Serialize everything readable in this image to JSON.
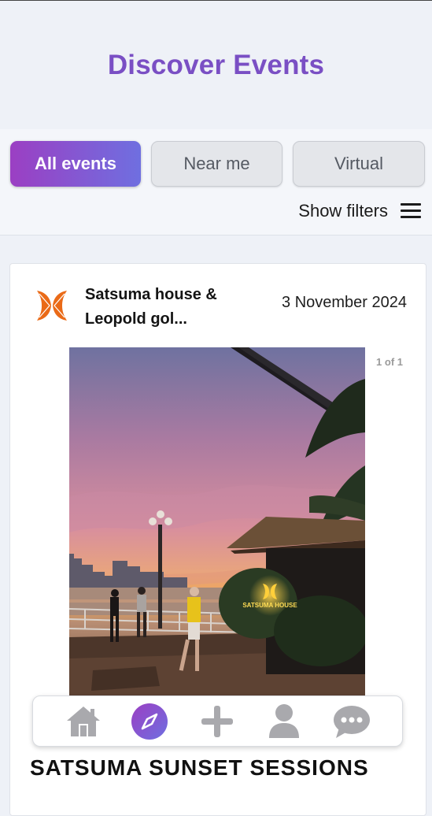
{
  "header": {
    "title": "Discover Events"
  },
  "tabs": [
    {
      "label": "All events",
      "active": true
    },
    {
      "label": "Near me",
      "active": false
    },
    {
      "label": "Virtual",
      "active": false
    }
  ],
  "filters": {
    "label": "Show filters",
    "icon": "hamburger-menu-icon"
  },
  "event_card": {
    "organizer": "Satsuma house & Leopold gol...",
    "date": "3 November 2024",
    "image_counter": "1 of 1",
    "image_sign_text": "SATSUMA HOUSE",
    "title": "SATSUMA SUNSET SESSIONS"
  },
  "bottom_nav": [
    {
      "icon": "home-icon",
      "active": false
    },
    {
      "icon": "compass-icon",
      "active": true
    },
    {
      "icon": "plus-icon",
      "active": false
    },
    {
      "icon": "user-icon",
      "active": false
    },
    {
      "icon": "chat-icon",
      "active": false
    }
  ],
  "colors": {
    "accent": "#7a4fc4",
    "tab_gradient_start": "#9b3fc3",
    "tab_gradient_end": "#6f6fe0",
    "logo_orange": "#ea6a17",
    "nav_icon_gray": "#a9a9ad"
  }
}
